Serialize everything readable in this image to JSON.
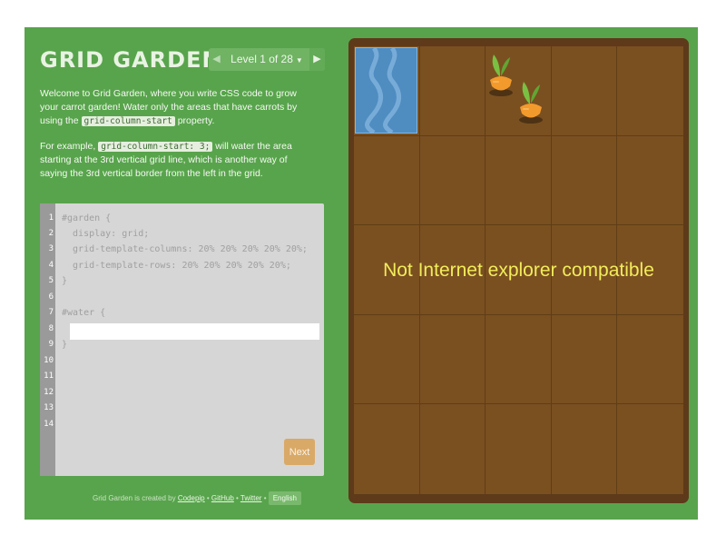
{
  "header": {
    "title": "GRID GARDEN",
    "level_label": "Level 1 of 28",
    "prev_icon": "chevron-left-icon",
    "next_icon": "chevron-right-icon",
    "dropdown_icon": "caret-down-icon"
  },
  "instructions": {
    "p1_text_a": "Welcome to Grid Garden, where you write CSS code to grow your carrot garden! Water only the areas that have carrots by using the ",
    "p1_code": "grid-column-start",
    "p1_text_b": " property.",
    "p2_text_a": "For example, ",
    "p2_code": "grid-column-start: 3;",
    "p2_text_b": " will water the area starting at the 3rd vertical grid line, which is another way of saying the 3rd vertical border from the left in the grid."
  },
  "editor": {
    "line_numbers": [
      "1",
      "2",
      "3",
      "4",
      "5",
      "6",
      "7",
      "8",
      "9",
      "10",
      "11",
      "12",
      "13",
      "14"
    ],
    "lines": [
      "#garden {",
      "  display: grid;",
      "  grid-template-columns: 20% 20% 20% 20% 20%;",
      "  grid-template-rows: 20% 20% 20% 20% 20%;",
      "}",
      "",
      "#water {",
      "",
      "}"
    ],
    "input_value": "",
    "next_label": "Next"
  },
  "footer": {
    "prefix": "Grid Garden is created by ",
    "codepip": "Codepip",
    "sep": " • ",
    "github": "GitHub",
    "twitter": "Twitter",
    "language": "English"
  },
  "garden": {
    "columns": 5,
    "rows": 5,
    "water_cell": {
      "row": 1,
      "column": 1
    },
    "carrot_cells": [
      {
        "row": 1,
        "column": 3
      },
      {
        "row": 1,
        "column": 3
      }
    ],
    "overlay_text": "Not Internet explorer compatible"
  },
  "colors": {
    "background": "#58a44c",
    "soil": "#7a5020",
    "water": "#4f8cc0",
    "carrot": "#f39a2c",
    "leaf": "#7ac043",
    "next_button": "#d9a968",
    "overlay_text": "#f2ec5b"
  }
}
